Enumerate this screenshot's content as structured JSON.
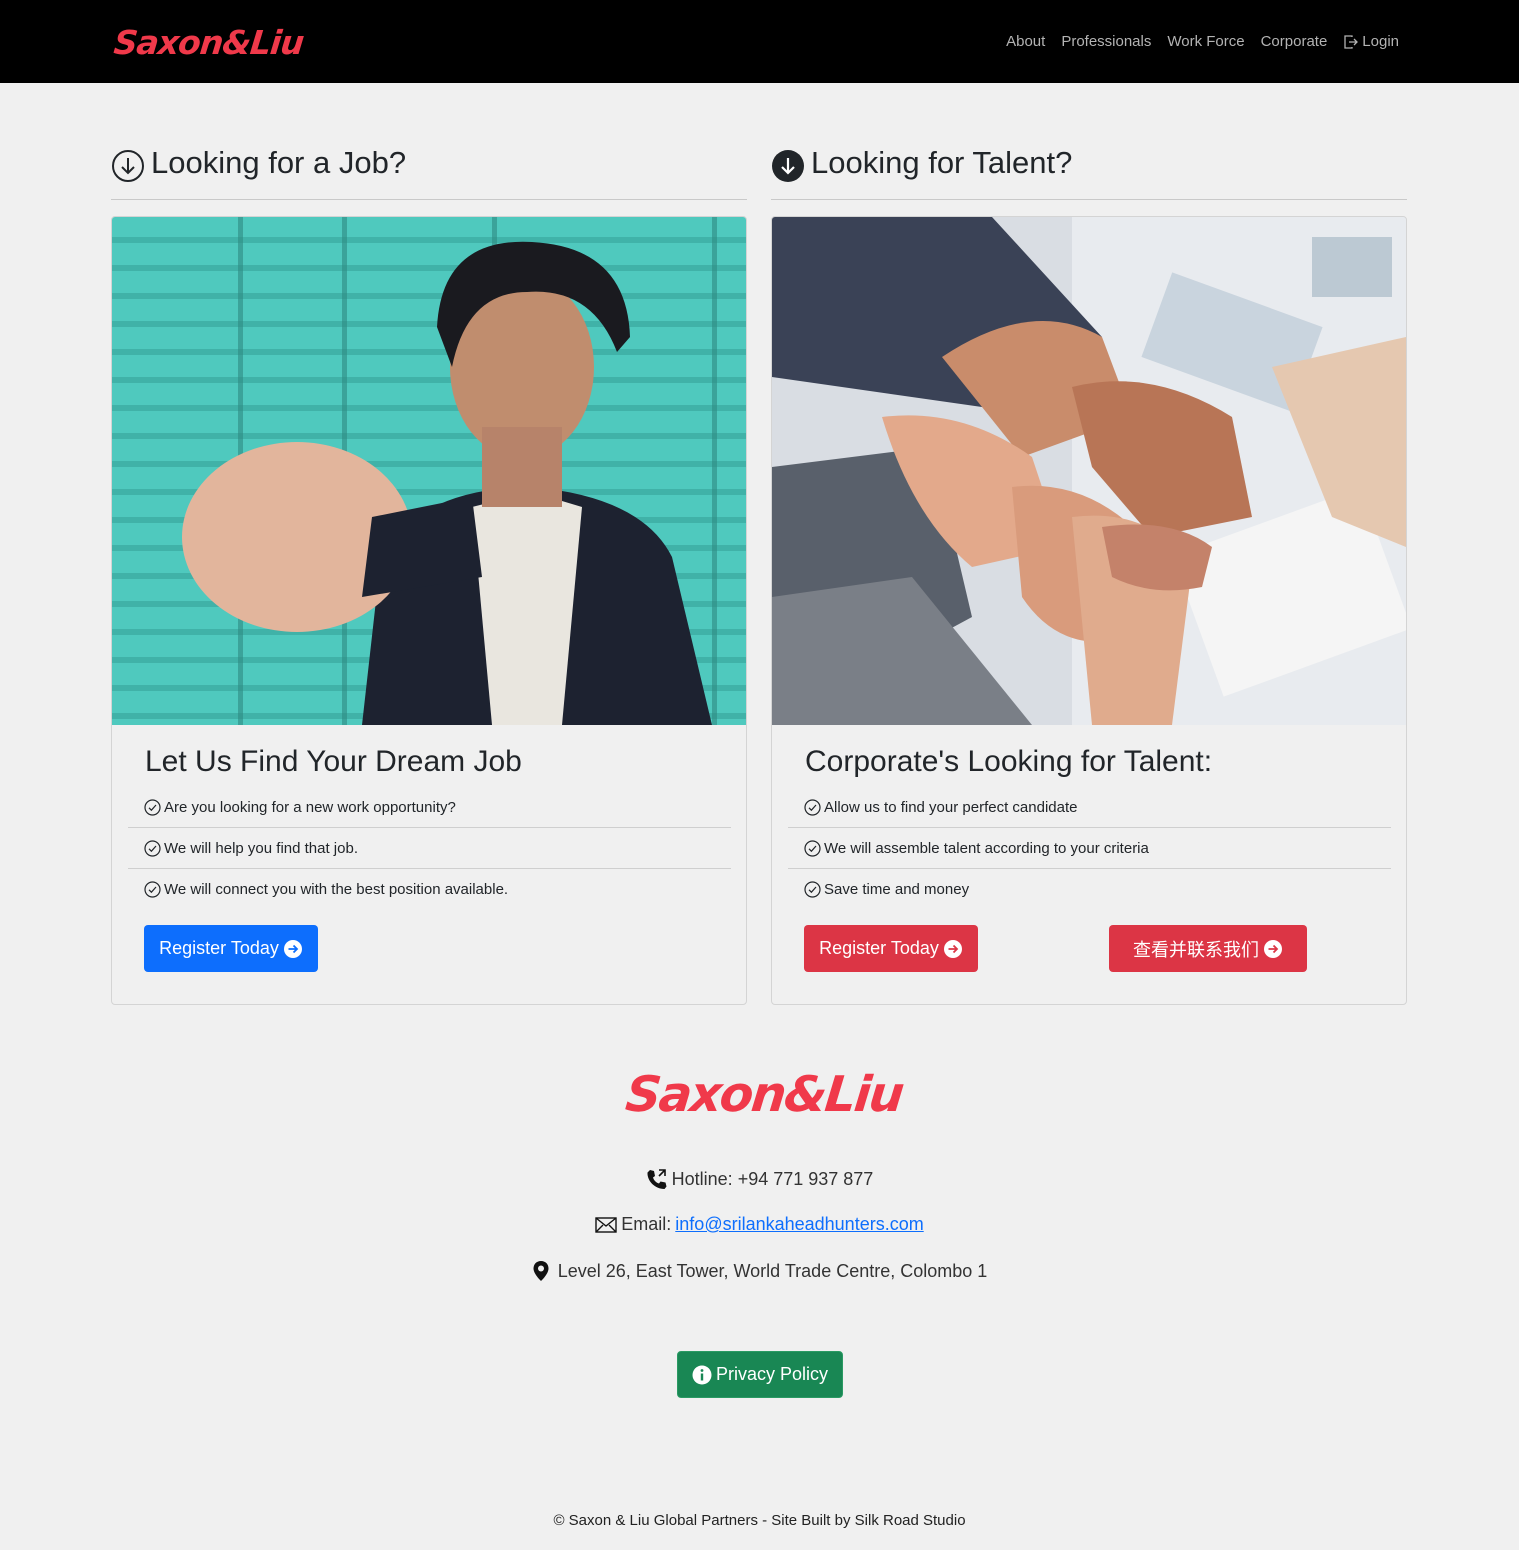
{
  "brand": "Saxon&Liu",
  "nav": {
    "about": "About",
    "professionals": "Professionals",
    "workforce": "Work Force",
    "corporate": "Corporate",
    "login": "Login"
  },
  "job": {
    "heading": "Looking for a Job?",
    "card_title": "Let Us Find Your Dream Job",
    "items": [
      "Are you looking for a new work opportunity?",
      "We will help you find that job.",
      "We will connect you with the best position available."
    ],
    "button": "Register Today",
    "image_icon": "man-with-fist-photo"
  },
  "talent": {
    "heading": "Looking for Talent?",
    "card_title": "Corporate's Looking for Talent:",
    "items": [
      "Allow us to find your perfect candidate",
      "We will assemble talent according to your criteria",
      "Save time and money"
    ],
    "button": "Register Today",
    "button_cn": "查看并联系我们",
    "image_icon": "joined-hands-photo"
  },
  "footer": {
    "logo": "Saxon&Liu",
    "hotline": "Hotline: +94 771 937 877",
    "email_label": "Email:",
    "email": "info@srilankaheadhunters.com",
    "address": "Level 26, East Tower, World Trade Centre, Colombo 1",
    "privacy": "Privacy Policy",
    "copyright": "© Saxon & Liu Global Partners - Site Built by Silk Road Studio"
  },
  "colors": {
    "brand": "#f0394a",
    "navbar": "#000000",
    "page_bg": "#f0f0f0",
    "primary": "#0d6efd",
    "danger": "#dc3545",
    "success": "#198754"
  }
}
